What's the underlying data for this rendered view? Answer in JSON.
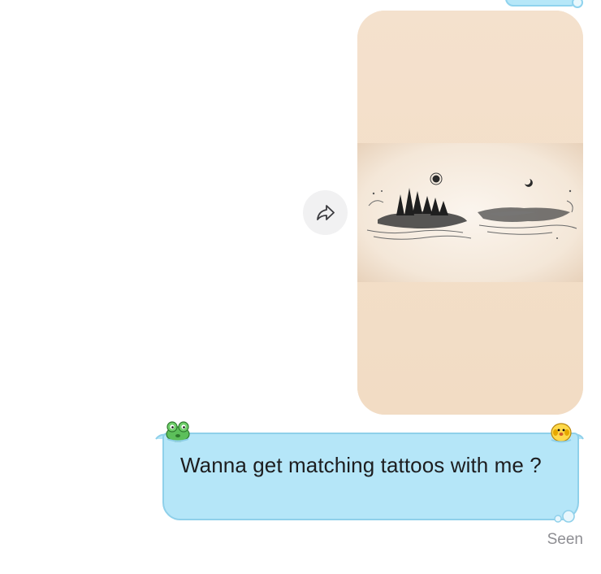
{
  "chat": {
    "image_message": {
      "description_icon": "tattoo-design-image"
    },
    "forward": {
      "icon": "share-arrow-icon"
    },
    "text_message": {
      "text": "Wanna get matching tattoos with me ?",
      "decorations": [
        "frog-sticker-icon",
        "chick-sticker-icon"
      ]
    },
    "status": {
      "seen_label": "Seen"
    }
  },
  "colors": {
    "bubble_fill": "#b5e6f8",
    "bubble_border": "#8fd0ea",
    "image_bg": "#f3dfcb",
    "seen_text": "#8e8e93"
  }
}
